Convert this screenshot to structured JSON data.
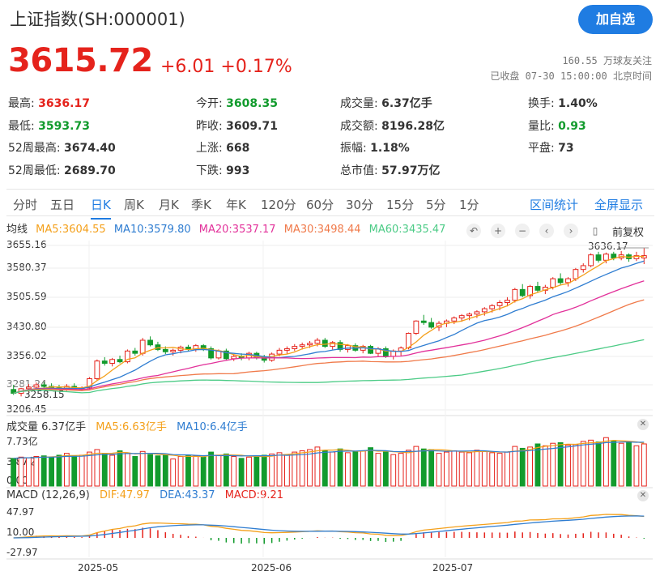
{
  "header": {
    "title": "上证指数(SH:000001)",
    "add_button": "加自选",
    "price": "3615.72",
    "change": "+6.01 +0.17%",
    "followers": "160.55 万球友关注",
    "status": "已收盘 07-30 15:00:00 北京时间"
  },
  "quote": {
    "high": {
      "label": "最高:",
      "value": "3636.17"
    },
    "low": {
      "label": "最低:",
      "value": "3593.73"
    },
    "wk52_high": {
      "label": "52周最高:",
      "value": "3674.40"
    },
    "wk52_low": {
      "label": "52周最低:",
      "value": "2689.70"
    },
    "open": {
      "label": "今开:",
      "value": "3608.35"
    },
    "prev_close": {
      "label": "昨收:",
      "value": "3609.71"
    },
    "up": {
      "label": "上涨:",
      "value": "668"
    },
    "down": {
      "label": "下跌:",
      "value": "993"
    },
    "volume": {
      "label": "成交量:",
      "value": "6.37亿手"
    },
    "amount": {
      "label": "成交额:",
      "value": "8196.28亿"
    },
    "amplitude": {
      "label": "振幅:",
      "value": "1.18%"
    },
    "market_cap": {
      "label": "总市值:",
      "value": "57.97万亿"
    },
    "turnover": {
      "label": "换手:",
      "value": "1.40%"
    },
    "vol_ratio": {
      "label": "量比:",
      "value": "0.93"
    },
    "flat": {
      "label": "平盘:",
      "value": "73"
    }
  },
  "tabs": [
    "分时",
    "五日",
    "日K",
    "周K",
    "月K",
    "季K",
    "年K",
    "120分",
    "60分",
    "30分",
    "15分",
    "5分",
    "1分"
  ],
  "active_tab": "日K",
  "tab_actions": [
    "区间统计",
    "全屏显示"
  ],
  "ma_legend": {
    "label": "均线",
    "ma5": "MA5:3604.55",
    "ma10": "MA10:3579.80",
    "ma20": "MA20:3537.17",
    "ma30": "MA30:3498.44",
    "ma60": "MA60:3435.47"
  },
  "controls": {
    "undo": "↶",
    "zoom_in": "+",
    "zoom_out": "−",
    "prev": "‹",
    "next": "›",
    "fq": "前复权"
  },
  "volume_legend": {
    "label": "成交量 6.37亿手",
    "ma5": "MA5:6.63亿手",
    "ma10": "MA10:6.4亿手"
  },
  "macd_legend": {
    "label": "MACD (12,26,9)",
    "dif": "DIF:47.97",
    "dea": "DEA:43.37",
    "macd": "MACD:9.21"
  },
  "colors": {
    "up": "#e5231c",
    "down": "#129b2d",
    "ma5": "#f4a01b",
    "ma10": "#2f7dd1",
    "ma20": "#e2319a",
    "ma30": "#f07a4a",
    "ma60": "#4ccb86",
    "accent": "#1f7ce2"
  },
  "chart_data": {
    "type": "candlestick",
    "y_ticks": [
      "3655.16",
      "3580.37",
      "3505.59",
      "3430.80",
      "3356.02",
      "3281.24",
      "3206.45"
    ],
    "ylim": [
      3206.45,
      3655.16
    ],
    "max_label": "3636.17",
    "min_label": "3258.15",
    "x_labels": [
      "2025-05",
      "2025-06",
      "2025-07"
    ],
    "candles": [
      [
        3268,
        3280,
        3254,
        3258
      ],
      [
        3258,
        3272,
        3250,
        3270
      ],
      [
        3270,
        3282,
        3262,
        3274
      ],
      [
        3274,
        3286,
        3270,
        3280
      ],
      [
        3280,
        3288,
        3270,
        3276
      ],
      [
        3276,
        3284,
        3268,
        3272
      ],
      [
        3272,
        3280,
        3266,
        3270
      ],
      [
        3270,
        3282,
        3264,
        3276
      ],
      [
        3276,
        3284,
        3268,
        3270
      ],
      [
        3270,
        3276,
        3264,
        3272
      ],
      [
        3272,
        3300,
        3268,
        3296
      ],
      [
        3296,
        3346,
        3292,
        3342
      ],
      [
        3342,
        3352,
        3330,
        3336
      ],
      [
        3336,
        3350,
        3328,
        3346
      ],
      [
        3346,
        3356,
        3336,
        3340
      ],
      [
        3340,
        3372,
        3336,
        3368
      ],
      [
        3368,
        3376,
        3356,
        3362
      ],
      [
        3362,
        3402,
        3356,
        3396
      ],
      [
        3396,
        3406,
        3380,
        3384
      ],
      [
        3384,
        3392,
        3368,
        3372
      ],
      [
        3372,
        3380,
        3360,
        3366
      ],
      [
        3366,
        3374,
        3356,
        3370
      ],
      [
        3370,
        3382,
        3362,
        3378
      ],
      [
        3378,
        3384,
        3368,
        3372
      ],
      [
        3372,
        3386,
        3366,
        3382
      ],
      [
        3382,
        3386,
        3368,
        3374
      ],
      [
        3374,
        3380,
        3346,
        3350
      ],
      [
        3350,
        3372,
        3346,
        3368
      ],
      [
        3368,
        3374,
        3344,
        3348
      ],
      [
        3348,
        3360,
        3342,
        3354
      ],
      [
        3354,
        3362,
        3344,
        3350
      ],
      [
        3350,
        3366,
        3344,
        3362
      ],
      [
        3362,
        3366,
        3346,
        3352
      ],
      [
        3352,
        3358,
        3338,
        3344
      ],
      [
        3344,
        3364,
        3340,
        3360
      ],
      [
        3360,
        3376,
        3354,
        3370
      ],
      [
        3370,
        3380,
        3360,
        3374
      ],
      [
        3374,
        3386,
        3368,
        3380
      ],
      [
        3380,
        3390,
        3372,
        3384
      ],
      [
        3384,
        3394,
        3376,
        3388
      ],
      [
        3388,
        3402,
        3380,
        3396
      ],
      [
        3396,
        3402,
        3376,
        3380
      ],
      [
        3380,
        3394,
        3372,
        3390
      ],
      [
        3390,
        3396,
        3366,
        3372
      ],
      [
        3372,
        3386,
        3364,
        3382
      ],
      [
        3382,
        3388,
        3366,
        3370
      ],
      [
        3370,
        3384,
        3362,
        3380
      ],
      [
        3380,
        3384,
        3360,
        3362
      ],
      [
        3362,
        3378,
        3354,
        3374
      ],
      [
        3374,
        3380,
        3350,
        3354
      ],
      [
        3354,
        3372,
        3346,
        3368
      ],
      [
        3368,
        3380,
        3356,
        3376
      ],
      [
        3376,
        3416,
        3372,
        3414
      ],
      [
        3414,
        3448,
        3410,
        3446
      ],
      [
        3446,
        3462,
        3436,
        3442
      ],
      [
        3442,
        3454,
        3426,
        3430
      ],
      [
        3430,
        3446,
        3420,
        3440
      ],
      [
        3440,
        3450,
        3430,
        3446
      ],
      [
        3446,
        3458,
        3438,
        3454
      ],
      [
        3454,
        3464,
        3444,
        3460
      ],
      [
        3460,
        3468,
        3448,
        3464
      ],
      [
        3464,
        3474,
        3454,
        3470
      ],
      [
        3470,
        3482,
        3460,
        3478
      ],
      [
        3478,
        3490,
        3468,
        3486
      ],
      [
        3486,
        3500,
        3474,
        3494
      ],
      [
        3494,
        3508,
        3484,
        3500
      ],
      [
        3500,
        3532,
        3494,
        3528
      ],
      [
        3528,
        3542,
        3508,
        3512
      ],
      [
        3512,
        3540,
        3504,
        3536
      ],
      [
        3536,
        3548,
        3520,
        3526
      ],
      [
        3526,
        3540,
        3516,
        3534
      ],
      [
        3534,
        3560,
        3528,
        3556
      ],
      [
        3556,
        3570,
        3540,
        3546
      ],
      [
        3546,
        3560,
        3536,
        3556
      ],
      [
        3556,
        3584,
        3550,
        3580
      ],
      [
        3580,
        3596,
        3572,
        3590
      ],
      [
        3590,
        3622,
        3586,
        3618
      ],
      [
        3618,
        3626,
        3598,
        3604
      ],
      [
        3604,
        3624,
        3596,
        3620
      ],
      [
        3620,
        3626,
        3604,
        3610
      ],
      [
        3610,
        3628,
        3604,
        3618
      ],
      [
        3618,
        3622,
        3600,
        3608
      ],
      [
        3608,
        3626,
        3602,
        3616
      ],
      [
        3610,
        3636,
        3594,
        3616
      ]
    ],
    "volume_ylim": [
      0,
      7.73
    ],
    "volume_ticks": [
      "7.73亿",
      "3.87亿",
      "0.00"
    ],
    "volume": [
      4.4,
      4.6,
      4.5,
      4.7,
      4.8,
      4.6,
      4.9,
      5.2,
      4.8,
      4.9,
      5.4,
      5.8,
      5.1,
      4.9,
      5.6,
      5.2,
      4.7,
      5.5,
      5.0,
      4.8,
      4.9,
      4.3,
      4.7,
      4.9,
      4.8,
      4.6,
      5.4,
      4.9,
      5.1,
      4.7,
      4.4,
      4.6,
      4.8,
      4.9,
      5.1,
      5.3,
      5.0,
      5.4,
      5.6,
      5.8,
      6.2,
      5.6,
      5.4,
      5.9,
      5.3,
      5.5,
      5.6,
      6.1,
      5.2,
      5.4,
      5.0,
      5.2,
      5.7,
      6.3,
      5.9,
      5.8,
      5.2,
      5.4,
      5.6,
      5.4,
      5.3,
      5.7,
      5.5,
      5.3,
      5.2,
      5.4,
      6.3,
      6.0,
      6.2,
      6.7,
      6.4,
      6.8,
      6.9,
      6.5,
      6.6,
      7.1,
      7.3,
      7.0,
      7.7,
      7.2,
      6.8,
      7.0,
      6.4,
      6.7
    ],
    "macd_ticks": [
      "47.97",
      "10.00",
      "-27.97"
    ],
    "macd_ylim": [
      -40,
      60
    ]
  }
}
